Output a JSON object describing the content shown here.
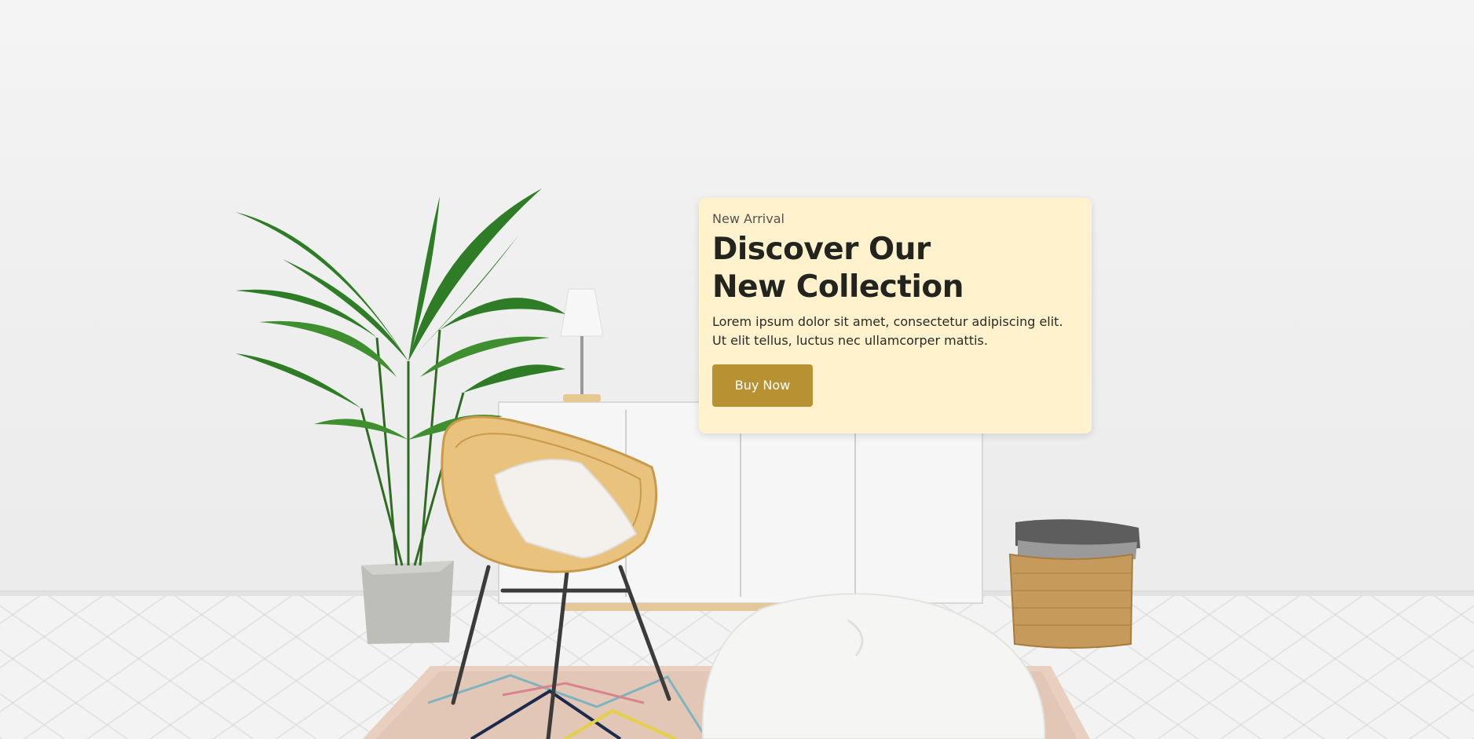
{
  "hero": {
    "eyebrow": "New Arrival",
    "headline": "Discover Our\nNew Collection",
    "description": "Lorem ipsum dolor sit amet, consectetur adipiscing elit. Ut elit tellus, luctus nec ullamcorper mattis.",
    "cta_label": "Buy Now"
  },
  "colors": {
    "card_background": "#fff2cc",
    "button": "#b89132",
    "heading_text": "#23231f",
    "wall": "#efefef"
  },
  "scene_objects": [
    "potted-palm-plant",
    "table-lamp",
    "white-sideboard-cabinet",
    "rattan-armchair-with-pillow",
    "white-bean-bag",
    "wicker-basket-with-folded-towels",
    "geometric-rug"
  ]
}
